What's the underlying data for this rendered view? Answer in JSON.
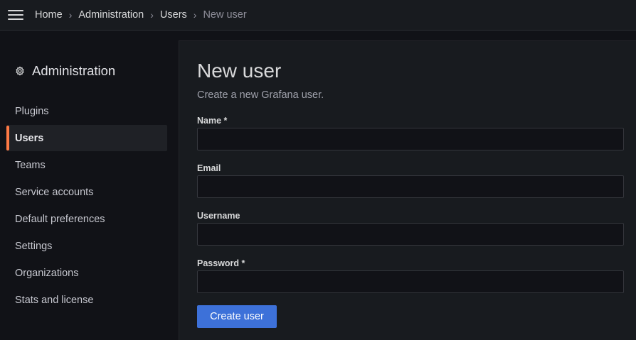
{
  "topbar": {
    "menu_icon": "hamburger-menu-icon",
    "breadcrumbs": [
      "Home",
      "Administration",
      "Users",
      "New user"
    ],
    "separator": "›"
  },
  "sidebar": {
    "title": "Administration",
    "title_icon": "gear-icon",
    "items": [
      {
        "label": "Plugins",
        "active": false
      },
      {
        "label": "Users",
        "active": true
      },
      {
        "label": "Teams",
        "active": false
      },
      {
        "label": "Service accounts",
        "active": false
      },
      {
        "label": "Default preferences",
        "active": false
      },
      {
        "label": "Settings",
        "active": false
      },
      {
        "label": "Organizations",
        "active": false
      },
      {
        "label": "Stats and license",
        "active": false
      }
    ]
  },
  "main": {
    "title": "New user",
    "subtitle": "Create a new Grafana user.",
    "fields": [
      {
        "label": "Name *",
        "value": ""
      },
      {
        "label": "Email",
        "value": ""
      },
      {
        "label": "Username",
        "value": ""
      },
      {
        "label": "Password *",
        "value": ""
      }
    ],
    "submit_label": "Create user"
  },
  "colors": {
    "accent_active": "#ff7a45",
    "primary_button": "#3d71d9",
    "background": "#111217",
    "panel": "#181b1f"
  }
}
